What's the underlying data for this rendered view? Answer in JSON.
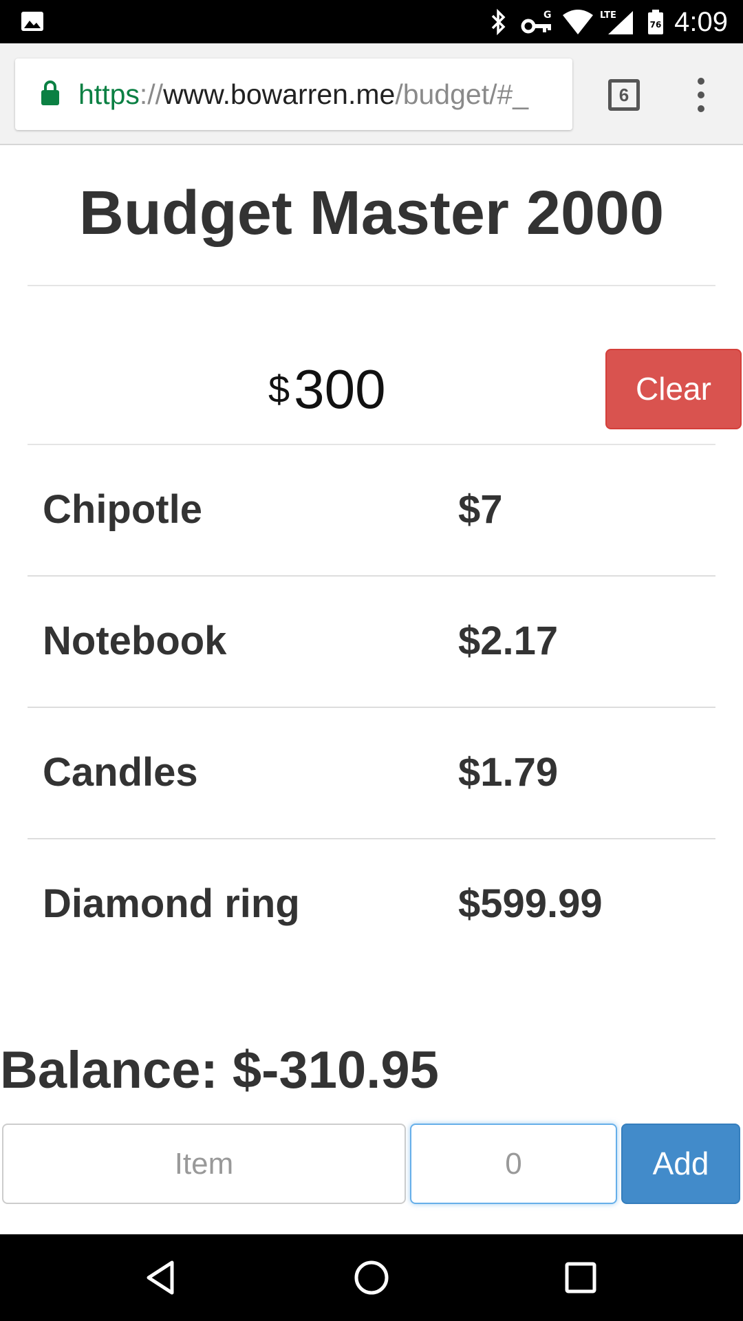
{
  "status_bar": {
    "time": "4:09",
    "battery_level": "76",
    "icons": [
      "gallery-icon",
      "bluetooth-icon",
      "vpn-key-icon",
      "wifi-icon",
      "lte-signal-icon",
      "battery-icon"
    ]
  },
  "browser": {
    "url_scheme": "https",
    "url_separator": "://",
    "url_host": "www.bowarren.me",
    "url_path": "/budget/#_",
    "tab_count": "6",
    "colors": {
      "secure_scheme": "#0b8043"
    }
  },
  "page": {
    "title": "Budget Master 2000",
    "budget": {
      "currency_symbol": "$",
      "amount": "300"
    },
    "clear_label": "Clear",
    "expenses": [
      {
        "name": "Chipotle",
        "cost": "$7"
      },
      {
        "name": "Notebook",
        "cost": "$2.17"
      },
      {
        "name": "Candles",
        "cost": "$1.79"
      },
      {
        "name": "Diamond ring",
        "cost": "$599.99"
      }
    ],
    "balance": "Balance: $-310.95",
    "form": {
      "item_placeholder": "Item",
      "item_value": "",
      "amount_placeholder": "0",
      "amount_value": "",
      "add_label": "Add"
    },
    "colors": {
      "clear_button": "#d9534f",
      "add_button": "#428bca",
      "focus_ring": "#66afe9"
    }
  },
  "nav_bar": {
    "icons": [
      "back-icon",
      "home-icon",
      "recents-icon"
    ]
  }
}
